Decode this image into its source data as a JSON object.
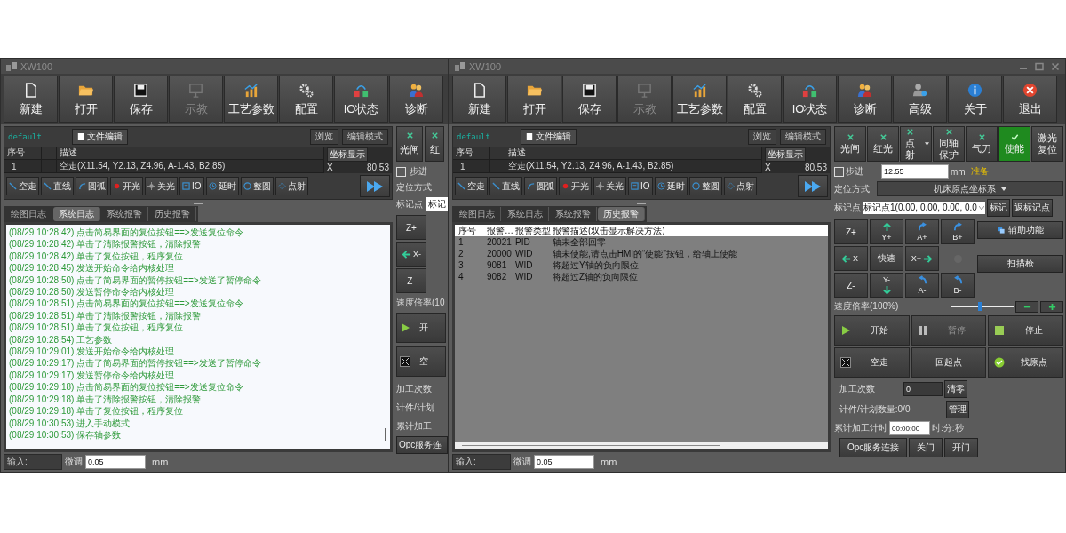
{
  "windows": [
    {
      "title": "XW100",
      "window_controls": false,
      "toolbar": [
        {
          "label": "新建",
          "disabled": false
        },
        {
          "label": "打开",
          "disabled": false
        },
        {
          "label": "保存",
          "disabled": false
        },
        {
          "label": "示教",
          "disabled": true
        },
        {
          "label": "工艺参数",
          "disabled": false
        },
        {
          "label": "配置",
          "disabled": false
        },
        {
          "label": "IO状态",
          "disabled": false
        },
        {
          "label": "诊断",
          "disabled": false
        }
      ],
      "program": {
        "file": "default",
        "edit_button": "文件编辑",
        "browse_button": "浏览",
        "mode_button": "编辑模式",
        "columns": [
          "序号",
          "描述"
        ],
        "rows": [
          {
            "index": "1",
            "text": "空走(X11.54, Y2.13, Z4.96, A-1.43, B2.85)"
          }
        ],
        "coord_button": "坐标显示",
        "coord_axis": "X",
        "coord_value": "80.53",
        "commands": [
          "空走",
          "直线",
          "圆弧",
          "开光",
          "关光",
          "IO",
          "延时",
          "整圆",
          "点射"
        ]
      },
      "tabs": [
        {
          "label": "绘图日志",
          "selected": false
        },
        {
          "label": "系统日志",
          "selected": true
        },
        {
          "label": "系统报警",
          "selected": false
        },
        {
          "label": "历史报警",
          "selected": false
        }
      ],
      "log": [
        "(08/29 10:28:42) 点击简易界面的复位按钮==>发送复位命令",
        "(08/29 10:28:42) 单击了清除报警按钮，清除报警",
        "(08/29 10:28:42) 单击了复位按钮，程序复位",
        "(08/29 10:28:45) 发送开始命令给内核处理",
        "(08/29 10:28:50) 点击了简易界面的暂停按钮==>发送了暂停命令",
        "(08/29 10:28:50) 发送暂停命令给内核处理",
        "(08/29 10:28:51) 点击简易界面的复位按钮==>发送复位命令",
        "(08/29 10:28:51) 单击了清除报警按钮，清除报警",
        "(08/29 10:28:51) 单击了复位按钮，程序复位",
        "(08/29 10:28:54) 工艺参数",
        "(08/29 10:29:01) 发送开始命令给内核处理",
        "(08/29 10:29:17) 点击了简易界面的暂停按钮==>发送了暂停命令",
        "(08/29 10:29:17) 发送暂停命令给内核处理",
        "(08/29 10:29:18) 点击简易界面的复位按钮==>发送复位命令",
        "(08/29 10:29:18) 单击了清除报警按钮，清除报警",
        "(08/29 10:29:18) 单击了复位按钮，程序复位",
        "(08/29 10:30:53) 进入手动模式",
        "(08/29 10:30:53) 保存轴参数"
      ],
      "input_label": "输入:",
      "fine_label": "微调",
      "fine_value": "0.05",
      "unit": "mm",
      "side_partial": {
        "toggles": [
          "光闸",
          "红"
        ],
        "step": {
          "label": "步进",
          "checked": false
        },
        "positioning": "定位方式",
        "mark": {
          "label": "标记点",
          "value": "标记"
        },
        "jog": [
          {
            "label": "Z+",
            "kind": "text"
          },
          {
            "label": "X-",
            "kind": "left"
          },
          {
            "label": "Z-",
            "kind": "text"
          }
        ],
        "speed": "速度倍率(10",
        "actions": [
          {
            "label": "开",
            "kind": "play"
          },
          {
            "label": "空",
            "kind": "expand"
          }
        ],
        "labels": [
          "加工次数",
          "计件/计划",
          "累计加工"
        ],
        "button": "Opc服务连"
      }
    },
    {
      "title": "XW100",
      "window_controls": true,
      "toolbar": [
        {
          "label": "新建",
          "disabled": false
        },
        {
          "label": "打开",
          "disabled": false
        },
        {
          "label": "保存",
          "disabled": false
        },
        {
          "label": "示教",
          "disabled": true
        },
        {
          "label": "工艺参数",
          "disabled": false
        },
        {
          "label": "配置",
          "disabled": false
        },
        {
          "label": "IO状态",
          "disabled": false
        },
        {
          "label": "诊断",
          "disabled": false
        },
        {
          "label": "高级",
          "disabled": false
        },
        {
          "label": "关于",
          "disabled": false
        },
        {
          "label": "退出",
          "disabled": false
        }
      ],
      "program": {
        "file": "default",
        "edit_button": "文件编辑",
        "browse_button": "浏览",
        "mode_button": "编辑模式",
        "columns": [
          "序号",
          "描述"
        ],
        "rows": [
          {
            "index": "1",
            "text": "空走(X11.54, Y2.13, Z4.96, A-1.43, B2.85)"
          }
        ],
        "coord_button": "坐标显示",
        "coord_axis": "X",
        "coord_value": "80.53",
        "commands": [
          "空走",
          "直线",
          "圆弧",
          "开光",
          "关光",
          "IO",
          "延时",
          "整圆",
          "点射"
        ]
      },
      "tabs": [
        {
          "label": "绘图日志",
          "selected": false
        },
        {
          "label": "系统日志",
          "selected": false
        },
        {
          "label": "系统报警",
          "selected": false
        },
        {
          "label": "历史报警",
          "selected": true
        }
      ],
      "alarms": {
        "columns": [
          "序号",
          "报警…",
          "报警类型",
          "报警描述(双击显示解决方法)"
        ],
        "rows": [
          [
            "1",
            "20021",
            "PID",
            "轴未全部回零"
          ],
          [
            "2",
            "20000",
            "WID",
            "轴未使能,请点击HMI的“使能”按钮，给轴上使能"
          ],
          [
            "3",
            "9081",
            "WID",
            "将超过Y轴的负向限位"
          ],
          [
            "4",
            "9082",
            "WID",
            "将超过Z轴的负向限位"
          ]
        ]
      },
      "input_label": "输入:",
      "fine_label": "微调",
      "fine_value": "0.05",
      "unit": "mm",
      "side": {
        "toggles": [
          {
            "label": "光闸",
            "kind": "toggle",
            "on": false
          },
          {
            "label": "红光",
            "kind": "toggle",
            "on": false
          },
          {
            "label": "点射",
            "kind": "dropdown",
            "on": false
          },
          {
            "label": "同轴保护",
            "kind": "toggle",
            "on": false
          },
          {
            "label": "气刀",
            "kind": "toggle",
            "on": false
          },
          {
            "label": "使能",
            "kind": "toggle",
            "on": true
          },
          {
            "label": "激光复位",
            "kind": "plain",
            "on": false
          }
        ],
        "step": {
          "label": "步进",
          "checked": false,
          "value": "12.55",
          "unit": "mm",
          "status": "准备"
        },
        "positioning": {
          "label": "定位方式",
          "value": "机床原点坐标系"
        },
        "mark": {
          "label": "标记点",
          "value": "标记点1(0.00, 0.00, 0.00, 0.0",
          "buttons": [
            "标记",
            "返标记点"
          ]
        },
        "jog": [
          {
            "label": "Z+",
            "kind": "text"
          },
          {
            "label": "Y+",
            "kind": "up"
          },
          {
            "label": "A+",
            "kind": "cw"
          },
          {
            "label": "B+",
            "kind": "cw"
          },
          {
            "label": "X-",
            "kind": "left"
          },
          {
            "label": "快速",
            "kind": "text"
          },
          {
            "label": "X+",
            "kind": "right"
          },
          {
            "kind": "indicator"
          },
          {
            "label": "Z-",
            "kind": "text"
          },
          {
            "label": "Y-",
            "kind": "down"
          },
          {
            "label": "A-",
            "kind": "ccw"
          },
          {
            "label": "B-",
            "kind": "ccw"
          }
        ],
        "aux_buttons": [
          "辅助功能",
          "扫描枪"
        ],
        "speed": {
          "label": "速度倍率(100%)",
          "level": 0.45
        },
        "actions": [
          {
            "label": "开始",
            "kind": "play",
            "disabled": false
          },
          {
            "label": "暂停",
            "kind": "pause",
            "disabled": true
          },
          {
            "label": "停止",
            "kind": "stop",
            "disabled": false
          },
          {
            "label": "空走",
            "kind": "expand",
            "disabled": false
          },
          {
            "label": "回起点",
            "kind": "plain",
            "disabled": false
          },
          {
            "label": "找原点",
            "kind": "check",
            "disabled": false
          }
        ],
        "count": {
          "label": "加工次数",
          "value": "0",
          "button": "清零"
        },
        "plan": {
          "text": "计件/计划数量:0/0",
          "button": "管理"
        },
        "timer": {
          "label": "累计加工计时",
          "value": "00:00:00",
          "unit": "时:分:秒"
        },
        "bottom_buttons": [
          "Opc服务连接",
          "关门",
          "开门"
        ]
      }
    }
  ]
}
